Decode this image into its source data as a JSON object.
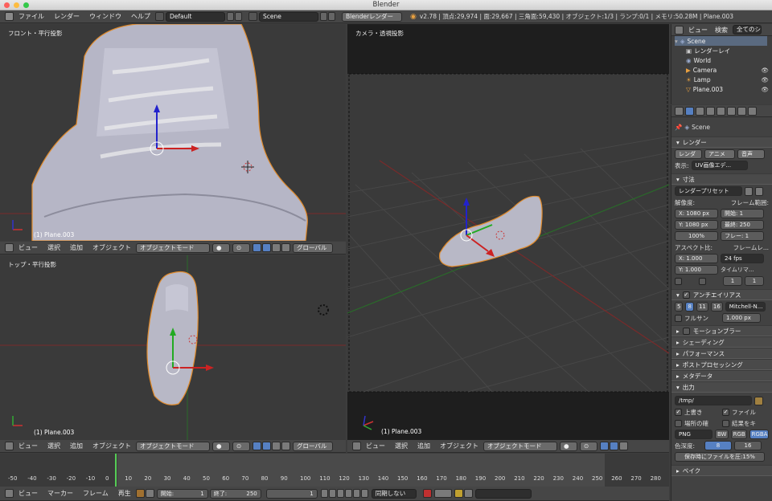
{
  "window": {
    "title": "Blender"
  },
  "topbar": {
    "menus": [
      "ファイル",
      "レンダー",
      "ウィンドウ",
      "ヘルプ"
    ],
    "layout": "Default",
    "scene": "Scene",
    "engine": "Blenderレンダー",
    "stats": "v2.78 | 頂点:29,974 | 面:29,667 | 三角面:59,430 | オブジェクト:1/3 | ランプ:0/1 | メモリ:50.28M | Plane.003"
  },
  "viewport_front": {
    "label": "フロント・平行投影",
    "object_label": "(1) Plane.003"
  },
  "viewport_top": {
    "label": "トップ・平行投影",
    "object_label": "(1) Plane.003"
  },
  "viewport_camera": {
    "label": "カメラ・透視投影",
    "object_label": "(1) Plane.003"
  },
  "view_header": {
    "view": "ビュー",
    "select": "選択",
    "add": "追加",
    "object": "オブジェクト",
    "mode": "オブジェクトモード",
    "orientation": "グローバル"
  },
  "outliner": {
    "tab_view": "ビュー",
    "tab_search": "検索",
    "tab_all": "全てのシー",
    "items": [
      "Scene",
      "レンダーレイ",
      "World",
      "Camera",
      "Lamp",
      "Plane.003"
    ]
  },
  "properties": {
    "scene_name": "Scene",
    "render_section": "レンダー",
    "render_btn": "レンダ",
    "anim_btn": "アニメ",
    "audio_btn": "音声",
    "display_label": "表示:",
    "display_value": "UV画像エデ...",
    "dimensions_section": "寸法",
    "presets": "レンダープリセット",
    "resolution_label": "解像度:",
    "frame_range_label": "フレーム範囲:",
    "res_x": "X: 1080 px",
    "res_y": "Y: 1080 px",
    "res_pct": "100%",
    "frame_start": "開始: 1",
    "frame_end": "最終: 250",
    "frame_step": "フレー: 1",
    "aspect_label": "アスペクト比:",
    "framerate_label": "フレームレ...",
    "aspect_x": "X: 1.000",
    "aspect_y": "Y: 1.000",
    "fps": "24 fps",
    "time_remap": "タイムリマ...",
    "remap_old": "1",
    "remap_new": "1",
    "aa_section": "アンチエイリアス",
    "aa_samples": [
      "5",
      "8",
      "11",
      "16"
    ],
    "aa_filter": "Mitchell-N...",
    "full_sample": "フルサン",
    "aa_size": "1.000 px",
    "sections": [
      "モーションブラー",
      "シェーディング",
      "パフォーマンス",
      "ポストプロセッシング",
      "メタデータ"
    ],
    "output_section": "出力",
    "output_path": "/tmp/",
    "overwrite": "上書き",
    "file_ext": "ファイル",
    "placeholders": "場所の確",
    "cache_result": "結果をキ",
    "format": "PNG",
    "color_modes": [
      "BW",
      "RGB",
      "RGBA"
    ],
    "color_depth_label": "色深度:",
    "color_depths": [
      "8",
      "16"
    ],
    "compression": "保存時にファイルを圧:15%",
    "bake_section": "ベイク"
  },
  "timeline": {
    "ticks": [
      "-50",
      "-40",
      "-30",
      "-20",
      "-10",
      "0",
      "10",
      "20",
      "30",
      "40",
      "50",
      "60",
      "70",
      "80",
      "90",
      "100",
      "110",
      "120",
      "130",
      "140",
      "150",
      "160",
      "170",
      "180",
      "190",
      "200",
      "210",
      "220",
      "230",
      "240",
      "250",
      "260",
      "270",
      "280"
    ],
    "current_frame": "1"
  },
  "bottom_header": {
    "view": "ビュー",
    "marker": "マーカー",
    "frame": "フレーム",
    "playback": "再生",
    "start": "開始:",
    "start_val": "1",
    "end": "終了:",
    "end_val": "250",
    "current": "1",
    "sync": "同期しない"
  }
}
